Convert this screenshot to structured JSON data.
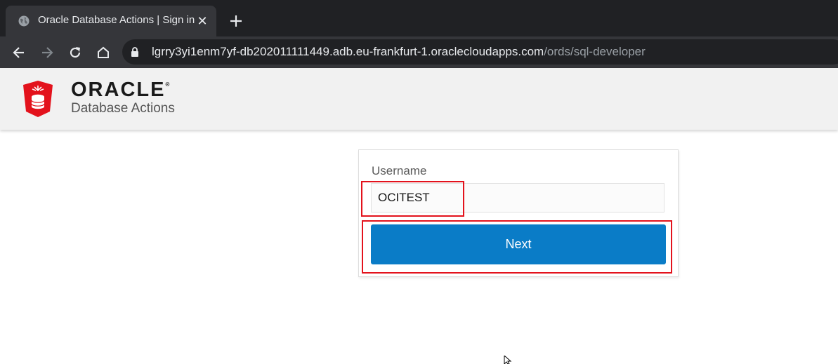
{
  "browser": {
    "tab_title": "Oracle Database Actions | Sign in",
    "tab_close_glyph": "✕",
    "url_host": "lgrry3yi1enm7yf-db202011111449.adb.eu-frankfurt-1.oraclecloudapps.com",
    "url_path": "/ords/sql-developer",
    "icons": [
      "globe-icon",
      "close-icon",
      "plus-icon",
      "back-icon",
      "forward-icon",
      "reload-icon",
      "home-icon",
      "lock-icon"
    ]
  },
  "header": {
    "brand": "ORACLE",
    "brand_mark": "®",
    "product": "Database Actions",
    "logo_color": "#e3121c"
  },
  "login": {
    "username_label": "Username",
    "username_value": "OCITEST",
    "next_label": "Next",
    "accent_color": "#0a7cc7",
    "highlight_color": "#e3121c"
  }
}
